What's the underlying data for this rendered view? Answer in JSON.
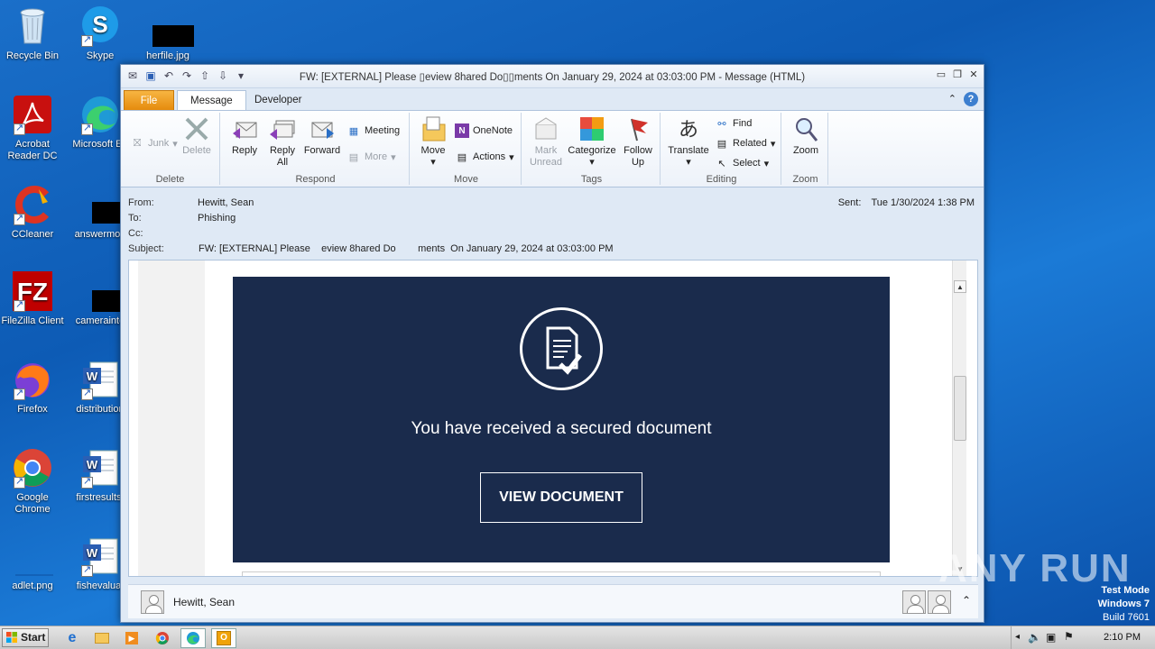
{
  "desktop": {
    "icons": [
      {
        "label": "Recycle Bin"
      },
      {
        "label": "Skype"
      },
      {
        "label": "herfile.jpg"
      },
      {
        "label": "Acrobat Reader DC"
      },
      {
        "label": "Microsoft Ed"
      },
      {
        "label": "CCleaner"
      },
      {
        "label": "answermon"
      },
      {
        "label": "FileZilla Client"
      },
      {
        "label": "camerainte"
      },
      {
        "label": "Firefox"
      },
      {
        "label": "distribution"
      },
      {
        "label": "Google Chrome"
      },
      {
        "label": "firstresults."
      },
      {
        "label": "adlet.png"
      },
      {
        "label": "fishevaluat"
      }
    ]
  },
  "window": {
    "title": "FW: [EXTERNAL] Please ▯eview 8hared Do▯▯ments  On January 29, 2024 at 03:03:00 PM  -  Message (HTML)",
    "tabs": [
      "File",
      "Message",
      "Developer"
    ]
  },
  "ribbon": {
    "delete_group": {
      "label": "Delete",
      "junk": "Junk",
      "delete": "Delete"
    },
    "respond_group": {
      "label": "Respond",
      "reply": "Reply",
      "reply_all": "Reply All",
      "forward": "Forward",
      "meeting": "Meeting",
      "more": "More"
    },
    "move_group": {
      "label": "Move",
      "move": "Move",
      "onenote": "OneNote",
      "actions": "Actions"
    },
    "tags_group": {
      "label": "Tags",
      "mark_unread": "Mark Unread",
      "categorize": "Categorize",
      "follow_up": "Follow Up"
    },
    "editing_group": {
      "label": "Editing",
      "translate": "Translate",
      "find": "Find",
      "related": "Related",
      "select": "Select"
    },
    "zoom_group": {
      "label": "Zoom",
      "zoom": "Zoom"
    }
  },
  "header": {
    "from_label": "From:",
    "from_value": "Hewitt, Sean",
    "to_label": "To:",
    "to_value": "Phishing",
    "cc_label": "Cc:",
    "cc_value": "",
    "subject_label": "Subject:",
    "subject_value": "FW: [EXTERNAL] Please    eview 8hared Do        ments  On January 29, 2024 at 03:03:00 PM",
    "sent_label": "Sent:",
    "sent_value": "Tue 1/30/2024 1:38 PM"
  },
  "email_body": {
    "message": "You have received a secured document",
    "button": "VIEW DOCUMENT",
    "banner_color": "#1a2b4c"
  },
  "people_pane": {
    "name": "Hewitt, Sean"
  },
  "taskbar": {
    "start": "Start",
    "clock": "2:10 PM"
  },
  "watermark": {
    "line1": "Test Mode",
    "line2": "Windows 7",
    "line3": "Build 7601",
    "brand": "ANY RUN"
  }
}
